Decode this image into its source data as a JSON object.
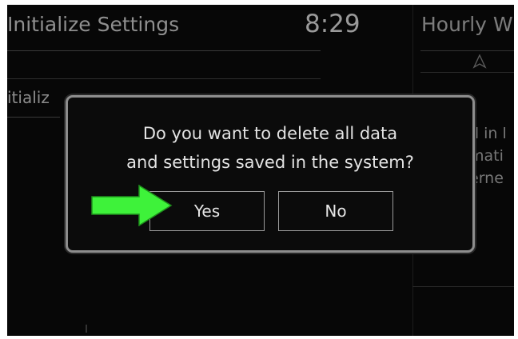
{
  "header": {
    "title": "Initialize Settings",
    "time": "8:29",
    "right_panel_title": "Hourly W"
  },
  "background": {
    "list_item": "itializ",
    "right_fragments": [
      "d in l",
      "mati",
      "erne"
    ]
  },
  "dialog": {
    "message_line1": "Do you want to delete all data",
    "message_line2": "and settings saved in the system?",
    "yes_label": "Yes",
    "no_label": "No"
  },
  "colors": {
    "screen_bg": "#070707",
    "dialog_border": "#8d8d8d",
    "pointer_arrow": "#3ef23a"
  },
  "icons": {
    "nav": "navigation-arrow-icon",
    "pointer": "green-arrow-pointer"
  }
}
